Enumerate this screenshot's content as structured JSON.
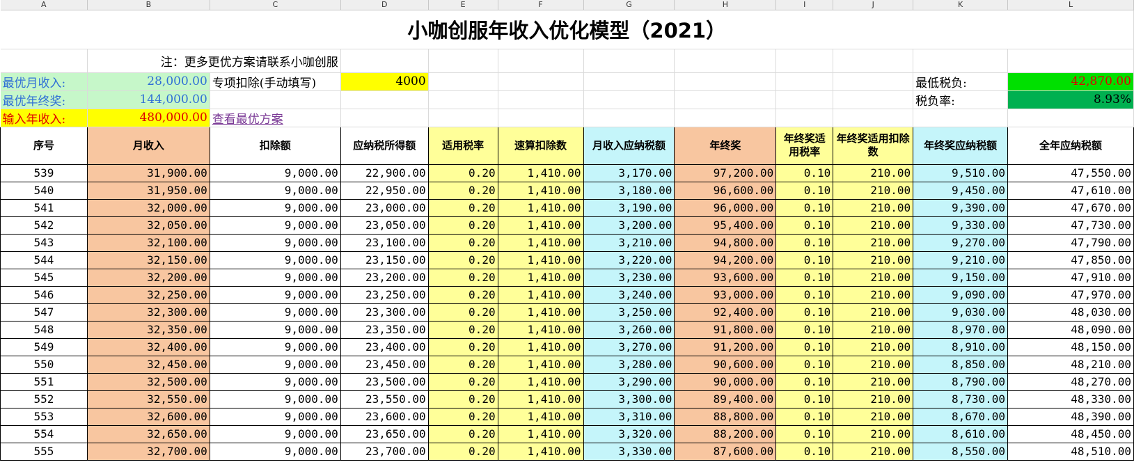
{
  "column_letters": [
    "A",
    "B",
    "C",
    "D",
    "E",
    "F",
    "G",
    "H",
    "I",
    "J",
    "K",
    "L"
  ],
  "title": "小咖创服年收入优化模型（2021）",
  "note": "注：更多更优方案请联系小咖创服",
  "summary": {
    "best_monthly_label": "最优月收入:",
    "best_monthly_value": "28,000.00",
    "best_bonus_label": "最优年终奖:",
    "best_bonus_value": "144,000.00",
    "annual_input_label": "输入年收入:",
    "annual_input_value": "480,000.00",
    "special_deduction_label": "专项扣除(手动填写)",
    "special_deduction_value": "4000",
    "view_plan_link": "查看最优方案",
    "min_tax_label": "最低税负:",
    "min_tax_value": "42,870.00",
    "tax_rate_label": "税负率:",
    "tax_rate_value": "8.93%"
  },
  "colors": {
    "light_green": "#c6f7c9",
    "yellow": "#ffff00",
    "bright_green": "#00e000",
    "dark_green": "#00b050",
    "orange": "#f8c6a0",
    "light_yellow": "#ffff99",
    "light_cyan": "#c5f5fa"
  },
  "table": {
    "headers": [
      "序号",
      "月收入",
      "扣除额",
      "应纳税所得额",
      "适用税率",
      "速算扣除数",
      "月收入应纳税额",
      "年终奖",
      "年终奖适用税率",
      "年终奖适用扣除数",
      "年终奖应纳税额",
      "全年应纳税额"
    ],
    "rows": [
      [
        "539",
        "31,900.00",
        "9,000.00",
        "22,900.00",
        "0.20",
        "1,410.00",
        "3,170.00",
        "97,200.00",
        "0.10",
        "210.00",
        "9,510.00",
        "47,550.00"
      ],
      [
        "540",
        "31,950.00",
        "9,000.00",
        "22,950.00",
        "0.20",
        "1,410.00",
        "3,180.00",
        "96,600.00",
        "0.10",
        "210.00",
        "9,450.00",
        "47,610.00"
      ],
      [
        "541",
        "32,000.00",
        "9,000.00",
        "23,000.00",
        "0.20",
        "1,410.00",
        "3,190.00",
        "96,000.00",
        "0.10",
        "210.00",
        "9,390.00",
        "47,670.00"
      ],
      [
        "542",
        "32,050.00",
        "9,000.00",
        "23,050.00",
        "0.20",
        "1,410.00",
        "3,200.00",
        "95,400.00",
        "0.10",
        "210.00",
        "9,330.00",
        "47,730.00"
      ],
      [
        "543",
        "32,100.00",
        "9,000.00",
        "23,100.00",
        "0.20",
        "1,410.00",
        "3,210.00",
        "94,800.00",
        "0.10",
        "210.00",
        "9,270.00",
        "47,790.00"
      ],
      [
        "544",
        "32,150.00",
        "9,000.00",
        "23,150.00",
        "0.20",
        "1,410.00",
        "3,220.00",
        "94,200.00",
        "0.10",
        "210.00",
        "9,210.00",
        "47,850.00"
      ],
      [
        "545",
        "32,200.00",
        "9,000.00",
        "23,200.00",
        "0.20",
        "1,410.00",
        "3,230.00",
        "93,600.00",
        "0.10",
        "210.00",
        "9,150.00",
        "47,910.00"
      ],
      [
        "546",
        "32,250.00",
        "9,000.00",
        "23,250.00",
        "0.20",
        "1,410.00",
        "3,240.00",
        "93,000.00",
        "0.10",
        "210.00",
        "9,090.00",
        "47,970.00"
      ],
      [
        "547",
        "32,300.00",
        "9,000.00",
        "23,300.00",
        "0.20",
        "1,410.00",
        "3,250.00",
        "92,400.00",
        "0.10",
        "210.00",
        "9,030.00",
        "48,030.00"
      ],
      [
        "548",
        "32,350.00",
        "9,000.00",
        "23,350.00",
        "0.20",
        "1,410.00",
        "3,260.00",
        "91,800.00",
        "0.10",
        "210.00",
        "8,970.00",
        "48,090.00"
      ],
      [
        "549",
        "32,400.00",
        "9,000.00",
        "23,400.00",
        "0.20",
        "1,410.00",
        "3,270.00",
        "91,200.00",
        "0.10",
        "210.00",
        "8,910.00",
        "48,150.00"
      ],
      [
        "550",
        "32,450.00",
        "9,000.00",
        "23,450.00",
        "0.20",
        "1,410.00",
        "3,280.00",
        "90,600.00",
        "0.10",
        "210.00",
        "8,850.00",
        "48,210.00"
      ],
      [
        "551",
        "32,500.00",
        "9,000.00",
        "23,500.00",
        "0.20",
        "1,410.00",
        "3,290.00",
        "90,000.00",
        "0.10",
        "210.00",
        "8,790.00",
        "48,270.00"
      ],
      [
        "552",
        "32,550.00",
        "9,000.00",
        "23,550.00",
        "0.20",
        "1,410.00",
        "3,300.00",
        "89,400.00",
        "0.10",
        "210.00",
        "8,730.00",
        "48,330.00"
      ],
      [
        "553",
        "32,600.00",
        "9,000.00",
        "23,600.00",
        "0.20",
        "1,410.00",
        "3,310.00",
        "88,800.00",
        "0.10",
        "210.00",
        "8,670.00",
        "48,390.00"
      ],
      [
        "554",
        "32,650.00",
        "9,000.00",
        "23,650.00",
        "0.20",
        "1,410.00",
        "3,320.00",
        "88,200.00",
        "0.10",
        "210.00",
        "8,610.00",
        "48,450.00"
      ],
      [
        "555",
        "32,700.00",
        "9,000.00",
        "23,700.00",
        "0.20",
        "1,410.00",
        "3,330.00",
        "87,600.00",
        "0.10",
        "210.00",
        "8,550.00",
        "48,510.00"
      ]
    ]
  }
}
